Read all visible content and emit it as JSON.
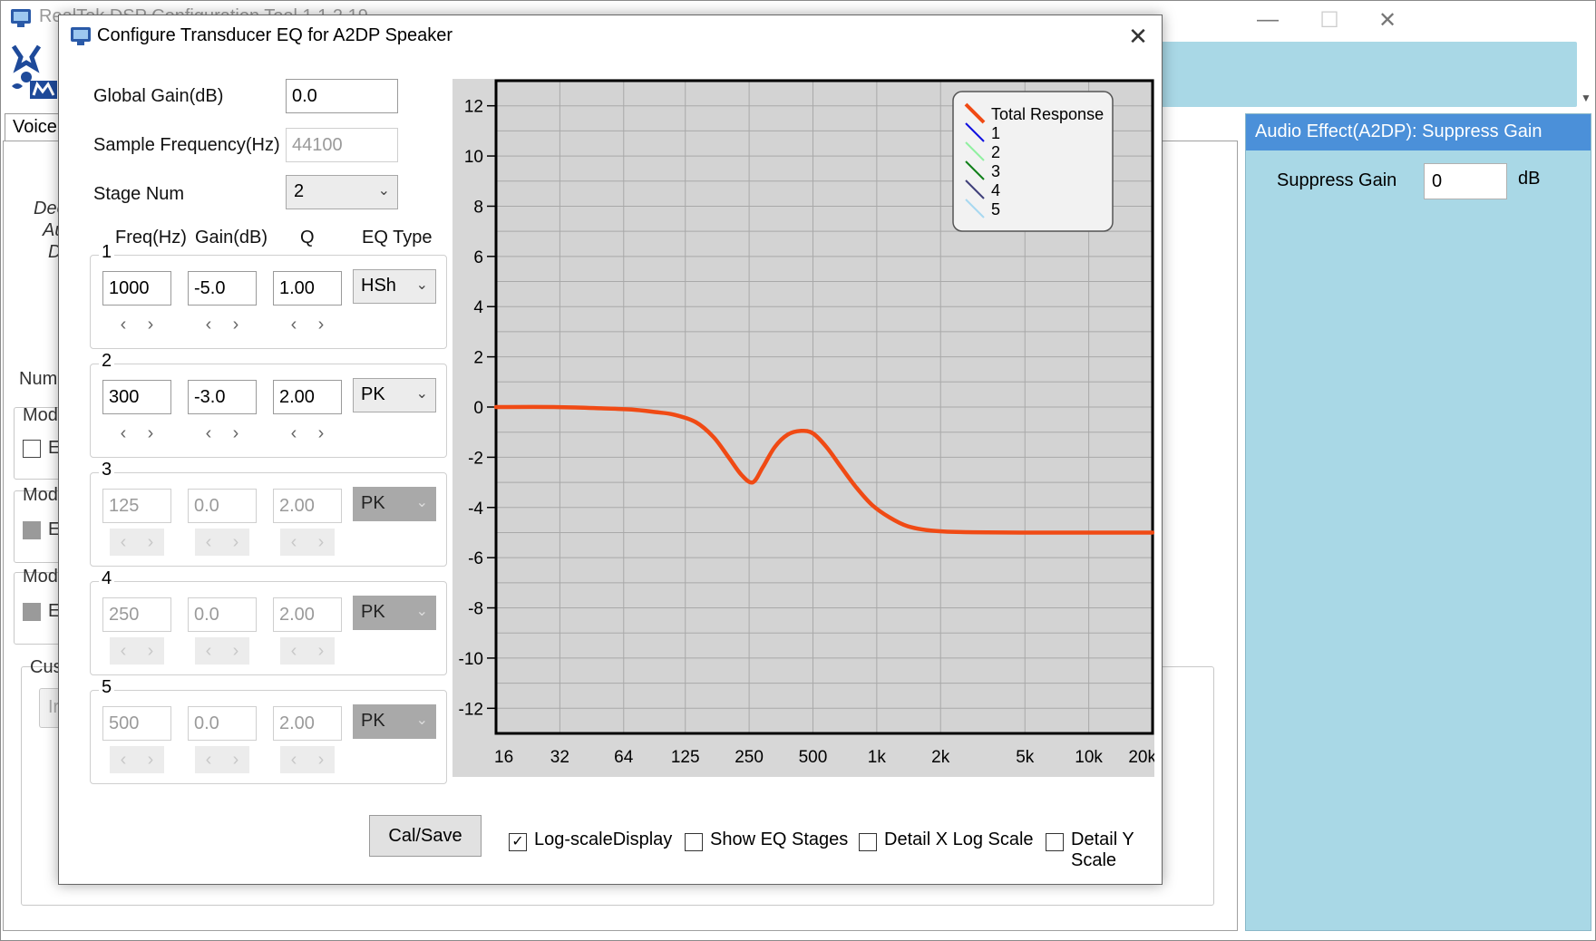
{
  "main_window": {
    "title": "RealTek DSP Configuration Tool 1.1.2.19",
    "minimize": "—",
    "maximize": "☐",
    "close": "✕",
    "voice_tab": "Voice",
    "ghost_texts": [
      "Dec",
      "Au",
      "D",
      "Num",
      "Mod",
      "E",
      "Mod",
      "E",
      "Mod",
      "E",
      "Cus",
      "Ir"
    ]
  },
  "right_panel": {
    "header": "Audio Effect(A2DP): Suppress Gain",
    "suppress_label": "Suppress Gain",
    "suppress_value": "0",
    "suppress_unit": "dB"
  },
  "dialog": {
    "title": "Configure Transducer EQ for A2DP Speaker",
    "close": "✕",
    "global_gain_label": "Global Gain(dB)",
    "global_gain_value": "0.0",
    "sample_freq_label": "Sample Frequency(Hz)",
    "sample_freq_value": "44100",
    "stage_num_label": "Stage Num",
    "stage_num_value": "2",
    "col_headers": {
      "freq": "Freq(Hz)",
      "gain": "Gain(dB)",
      "q": "Q",
      "eq_type": "EQ Type"
    },
    "stages": [
      {
        "num": "1",
        "freq": "1000",
        "gain": "-5.0",
        "q": "1.00",
        "type": "HSh",
        "enabled": true
      },
      {
        "num": "2",
        "freq": "300",
        "gain": "-3.0",
        "q": "2.00",
        "type": "PK",
        "enabled": true
      },
      {
        "num": "3",
        "freq": "125",
        "gain": "0.0",
        "q": "2.00",
        "type": "PK",
        "enabled": false
      },
      {
        "num": "4",
        "freq": "250",
        "gain": "0.0",
        "q": "2.00",
        "type": "PK",
        "enabled": false
      },
      {
        "num": "5",
        "freq": "500",
        "gain": "0.0",
        "q": "2.00",
        "type": "PK",
        "enabled": false
      }
    ],
    "spin_left": "‹",
    "spin_right": "›",
    "calsave_label": "Cal/Save",
    "options": [
      {
        "label": "Log-scaleDisplay",
        "checked": true
      },
      {
        "label": "Show EQ Stages",
        "checked": false
      },
      {
        "label": "Detail X Log Scale",
        "checked": false
      },
      {
        "label": "Detail Y Scale",
        "checked": false
      }
    ],
    "check_mark": "✓"
  },
  "colors": {
    "total_response": "#f04a14",
    "stage1": "#1010e0",
    "stage2": "#90f0a0",
    "stage3": "#10801a",
    "stage4": "#40407a",
    "stage5": "#a8d8f0",
    "panel_blue": "#a9d8e6",
    "header_blue": "#4b90d9"
  },
  "chart_data": {
    "type": "line",
    "x_scale": "log",
    "xlim": [
      16,
      20000
    ],
    "ylim": [
      -13,
      13
    ],
    "grid": true,
    "legend_position": "top-right",
    "x_ticks": [
      {
        "value": 16,
        "label": "16"
      },
      {
        "value": 32,
        "label": "32"
      },
      {
        "value": 64,
        "label": "64"
      },
      {
        "value": 125,
        "label": "125"
      },
      {
        "value": 250,
        "label": "250"
      },
      {
        "value": 500,
        "label": "500"
      },
      {
        "value": 1000,
        "label": "1k"
      },
      {
        "value": 2000,
        "label": "2k"
      },
      {
        "value": 5000,
        "label": "5k"
      },
      {
        "value": 10000,
        "label": "10k"
      },
      {
        "value": 20000,
        "label": "20k"
      }
    ],
    "y_ticks": [
      12,
      10,
      8,
      6,
      4,
      2,
      0,
      -2,
      -4,
      -6,
      -8,
      -10,
      -12
    ],
    "x_grid_values": [
      16,
      32,
      64,
      125,
      250,
      500,
      1000,
      2000,
      5000,
      10000,
      20000
    ],
    "legend": [
      "Total Response",
      "1",
      "2",
      "3",
      "4",
      "5"
    ],
    "series": [
      {
        "name": "Total Response",
        "points": [
          [
            16,
            0.0
          ],
          [
            30,
            0.0
          ],
          [
            50,
            -0.05
          ],
          [
            70,
            -0.1
          ],
          [
            90,
            -0.2
          ],
          [
            110,
            -0.3
          ],
          [
            140,
            -0.6
          ],
          [
            170,
            -1.2
          ],
          [
            200,
            -2.0
          ],
          [
            230,
            -2.7
          ],
          [
            260,
            -3.0
          ],
          [
            290,
            -2.4
          ],
          [
            330,
            -1.6
          ],
          [
            380,
            -1.1
          ],
          [
            440,
            -0.95
          ],
          [
            500,
            -1.05
          ],
          [
            580,
            -1.6
          ],
          [
            680,
            -2.4
          ],
          [
            800,
            -3.2
          ],
          [
            950,
            -3.9
          ],
          [
            1150,
            -4.4
          ],
          [
            1400,
            -4.75
          ],
          [
            1800,
            -4.92
          ],
          [
            2500,
            -4.98
          ],
          [
            5000,
            -5.0
          ],
          [
            10000,
            -5.0
          ],
          [
            20000,
            -5.0
          ]
        ]
      }
    ]
  }
}
